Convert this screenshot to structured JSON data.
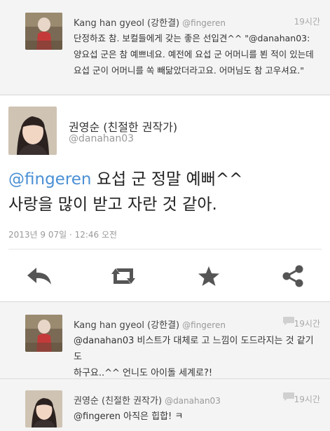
{
  "replies_top": {
    "author": "Kang han gyeol (강한결)",
    "handle": "@fingeren",
    "time": "19시간",
    "lines": [
      "단정하죠 참. 보컬들에게 갖는 좋은 선입견^^ \"@danahan03:",
      "양요섭 군은 참 예쁘네요. 예전에 요섭 군 어머니를 뵌 적이 있는데",
      "요섭 군이 어머니를 쏙 빼닮았더라고요. 어머님도 참 고우셔요.\""
    ]
  },
  "main_tweet": {
    "display_name": "권영순 (친절한 권작가)",
    "handle": "@danahan03",
    "mention": "@fingeren",
    "text_line1": " 요섭 군 정말 예뻐^^",
    "text_line2": "사랑을 많이 받고 자란 것 같아.",
    "timestamp": "2013년 9 07일 · 12:46 오전"
  },
  "actions": {
    "reply": "reply-icon",
    "retweet": "retweet-icon",
    "favorite": "star-icon",
    "share": "share-icon"
  },
  "replies": [
    {
      "author": "Kang han gyeol (강한결)",
      "handle": "@fingeren",
      "time": "19시간",
      "lines": [
        "@danahan03 비스트가 대체로 고 느낌이 도드라지는 것 같기도",
        "하구요..^^ 언니도 아이돌 세계로?!"
      ]
    },
    {
      "author": "권영순 (친절한 권작가)",
      "handle": "@danahan03",
      "time": "19시간",
      "lines": [
        "@fingeren 아직은 힙합! ㅋ"
      ]
    }
  ],
  "colors": {
    "mention": "#4a8fd4",
    "icon_gray": "#555555",
    "background": "#f4f4f4"
  }
}
